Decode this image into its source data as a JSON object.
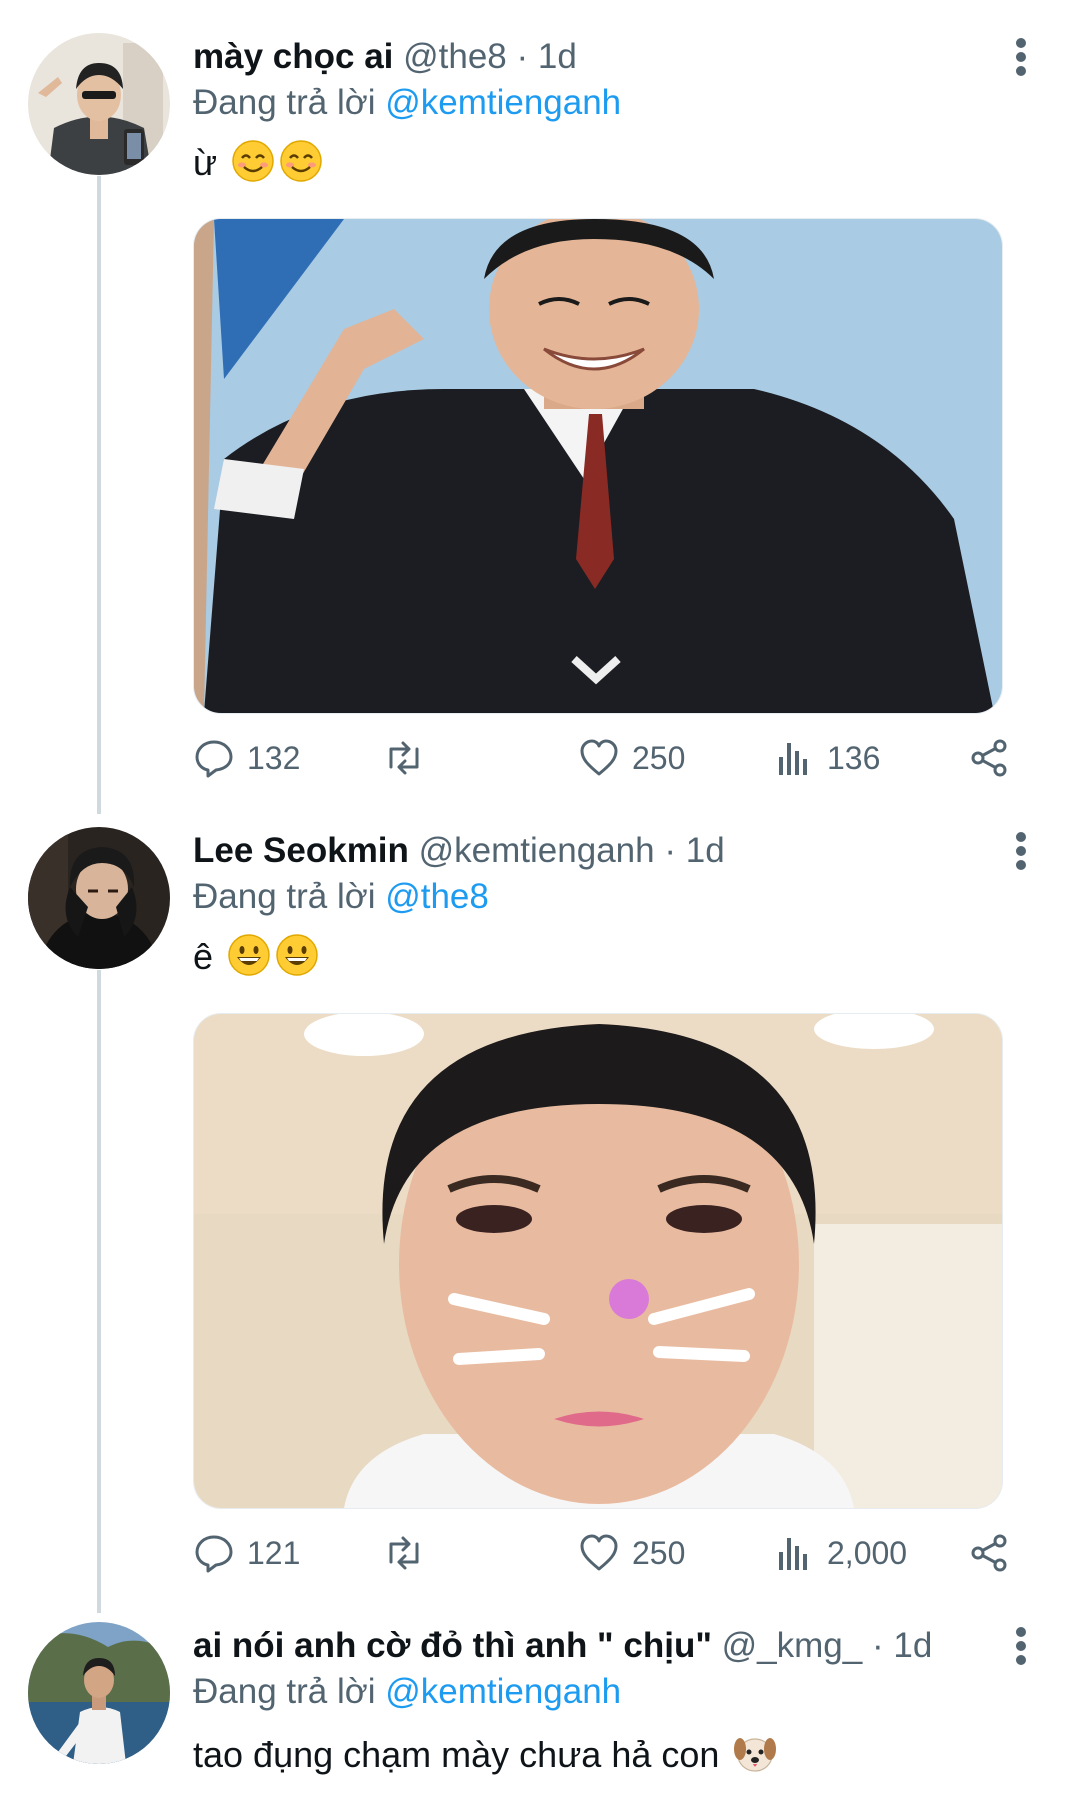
{
  "tweets": [
    {
      "display_name": "mày chọc ai",
      "handle": "@the8",
      "separator": "·",
      "time": "1d",
      "reply_prefix": "Đang trả lời",
      "reply_to": "@kemtienganh",
      "text": "ừ",
      "emojis": [
        "smiling-face-icon",
        "smiling-face-icon"
      ],
      "media": "photo of smiling student in black school uniform making hand gesture",
      "replies": "132",
      "retweets": "",
      "likes": "250",
      "views": "136"
    },
    {
      "display_name": "Lee Seokmin",
      "handle": "@kemtienganh",
      "separator": "·",
      "time": "1d",
      "reply_prefix": "Đang trả lời",
      "reply_to": "@the8",
      "text": "ê",
      "emojis": [
        "grinning-face-icon",
        "grinning-face-icon"
      ],
      "media": "close-up selfie with cat whisker filter and bunny ears",
      "replies": "121",
      "retweets": "",
      "likes": "250",
      "views": "2,000"
    },
    {
      "display_name": "ai nói anh cờ đỏ thì anh \" chịu\"",
      "handle": "@_kmg_",
      "separator": "·",
      "time": "1d",
      "reply_prefix": "Đang trả lời",
      "reply_to": "@kemtienganh",
      "text": "tao đụng chạm mày chưa hả con",
      "emojis": [
        "dog-face-icon"
      ]
    }
  ],
  "colors": {
    "accent": "#1d9bf0",
    "secondary_text": "#536471",
    "primary_text": "#0f1419",
    "thread_line": "#cfd9de"
  }
}
